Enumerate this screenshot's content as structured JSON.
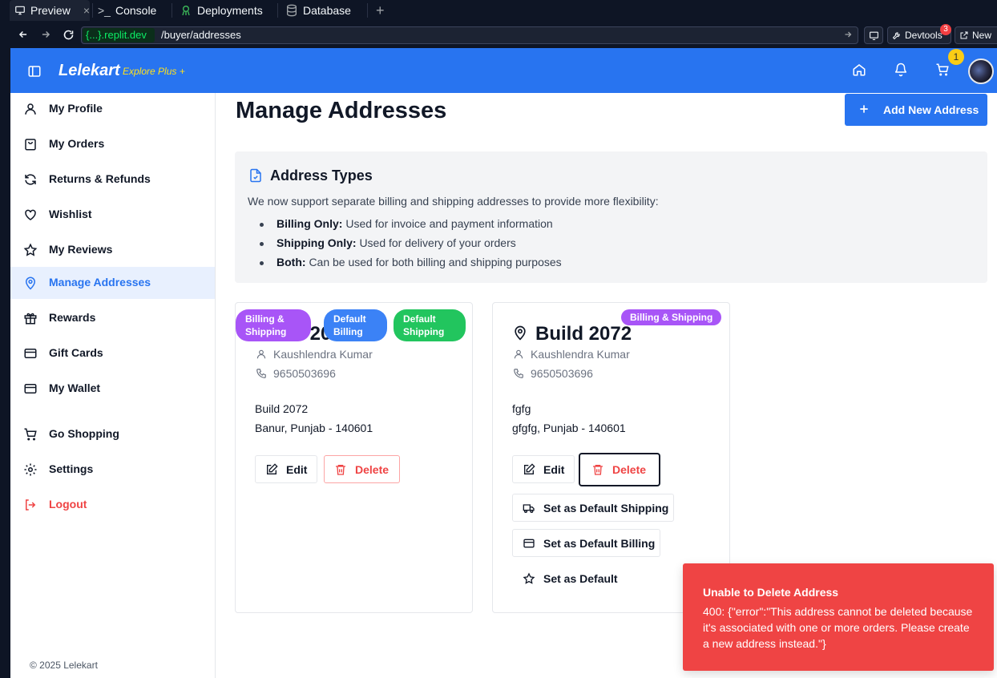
{
  "browser": {
    "tabs": [
      {
        "label": "Preview",
        "active": true
      },
      {
        "label": "Console"
      },
      {
        "label": "Deployments"
      },
      {
        "label": "Database"
      }
    ],
    "url_host": "{...}.replit.dev",
    "url_path": "/buyer/addresses",
    "devtools_label": "Devtools",
    "devtools_badge": "3",
    "new_tab_label": "New"
  },
  "header": {
    "brand": "Lelekart",
    "tagline": "Explore Plus +",
    "cart_count": "1",
    "brand_color": "#2874f0"
  },
  "sidebar": {
    "items": [
      {
        "label": "My Profile",
        "icon": "user-icon"
      },
      {
        "label": "My Orders",
        "icon": "shopping-bag-icon"
      },
      {
        "label": "Returns & Refunds",
        "icon": "refresh-icon"
      },
      {
        "label": "Wishlist",
        "icon": "heart-icon"
      },
      {
        "label": "My Reviews",
        "icon": "star-icon"
      },
      {
        "label": "Manage Addresses",
        "icon": "map-pin-icon",
        "active": true
      },
      {
        "label": "Rewards",
        "icon": "gift-icon"
      },
      {
        "label": "Gift Cards",
        "icon": "credit-card-icon"
      },
      {
        "label": "My Wallet",
        "icon": "wallet-icon"
      },
      {
        "label": "Go Shopping",
        "icon": "cart-icon"
      },
      {
        "label": "Settings",
        "icon": "gear-icon"
      },
      {
        "label": "Logout",
        "icon": "logout-icon"
      }
    ],
    "copyright": "© 2025 Lelekart"
  },
  "main": {
    "title": "Manage Addresses",
    "add_button": "Add New Address",
    "info": {
      "title": "Address Types",
      "description": "We now support separate billing and shipping addresses to provide more flexibility:",
      "bullets": [
        {
          "bold": "Billing Only:",
          "text": "Used for invoice and payment information"
        },
        {
          "bold": "Shipping Only:",
          "text": "Used for delivery of your orders"
        },
        {
          "bold": "Both:",
          "text": "Can be used for both billing and shipping purposes"
        }
      ]
    },
    "cards": [
      {
        "title": "Build 2072",
        "badges": [
          "Billing & Shipping",
          "Default Billing",
          "Default Shipping"
        ],
        "name": "Kaushlendra Kumar",
        "phone": "9650503696",
        "line1": "Build 2072",
        "line2": "Banur, Punjab - 140601",
        "edit": "Edit",
        "delete": "Delete"
      },
      {
        "title": "Build 2072",
        "badges": [
          "Billing & Shipping"
        ],
        "name": "Kaushlendra Kumar",
        "phone": "9650503696",
        "line1": "fgfg",
        "line2": "gfgfg, Punjab - 140601",
        "edit": "Edit",
        "delete": "Delete",
        "set_default_shipping": "Set as Default Shipping",
        "set_default_billing": "Set as Default Billing",
        "set_default": "Set as Default"
      }
    ]
  },
  "toast": {
    "title": "Unable to Delete Address",
    "message": "400: {\"error\":\"This address cannot be deleted because it's associated with one or more orders. Please create a new address instead.\"}"
  },
  "colors": {
    "purple": "#a855f7",
    "blue": "#3b82f6",
    "green": "#22c55e",
    "danger": "#ef4444"
  }
}
